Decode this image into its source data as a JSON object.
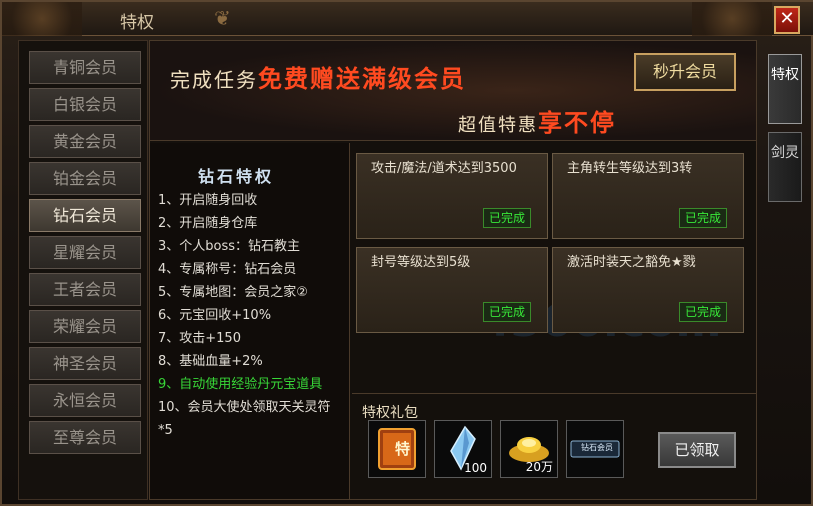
{
  "window": {
    "title": "特权",
    "close_label": "✕"
  },
  "sidebar": {
    "items": [
      {
        "label": "青铜会员"
      },
      {
        "label": "白银会员"
      },
      {
        "label": "黄金会员"
      },
      {
        "label": "铂金会员"
      },
      {
        "label": "钻石会员",
        "active": true
      },
      {
        "label": "星耀会员"
      },
      {
        "label": "王者会员"
      },
      {
        "label": "荣耀会员"
      },
      {
        "label": "神圣会员"
      },
      {
        "label": "永恒会员"
      },
      {
        "label": "至尊会员"
      }
    ]
  },
  "banner": {
    "line1_prefix": "完成任务",
    "line1_highlight": "免费赠送满级会员",
    "line2_prefix": "超值特惠",
    "line2_highlight": "享不停",
    "upgrade_button": "秒升会员"
  },
  "privileges": {
    "title": "钻石特权",
    "items": [
      {
        "text": "1、开启随身回收"
      },
      {
        "text": "2、开启随身仓库"
      },
      {
        "text": "3、个人boss：钻石教主"
      },
      {
        "text": "4、专属称号：钻石会员"
      },
      {
        "text": "5、专属地图：会员之家②"
      },
      {
        "text": "6、元宝回收+10%"
      },
      {
        "text": "7、攻击+150"
      },
      {
        "text": "8、基础血量+2%"
      },
      {
        "text": "9、自动使用经验丹元宝道具",
        "highlight": true
      },
      {
        "text": "10、会员大使处领取天关灵符*5"
      }
    ]
  },
  "tasks": [
    {
      "text": "攻击/魔法/道术达到3500",
      "status": "已完成"
    },
    {
      "text": "主角转生等级达到3转",
      "status": "已完成"
    },
    {
      "text": "封号等级达到5级",
      "status": "已完成"
    },
    {
      "text": "激活时装天之豁免★戮",
      "status": "已完成"
    }
  ],
  "gift": {
    "title": "特权礼包",
    "items": [
      {
        "icon": "vip-card-icon",
        "count": "",
        "badge": "特"
      },
      {
        "icon": "crystal-icon",
        "count": "100"
      },
      {
        "icon": "gold-ingot-icon",
        "count": "20万"
      },
      {
        "icon": "diamond-badge-icon",
        "count": "",
        "badge": "钻石会员"
      }
    ],
    "claim_button": "已领取"
  },
  "right_tabs": [
    {
      "label": "特权",
      "active": true
    },
    {
      "label": "剑灵"
    }
  ],
  "watermark": "4366.com",
  "colors": {
    "accent_red": "#ff4a20",
    "done_green": "#38e838",
    "active_item_text": "#f0e8d8",
    "inactive_item_text": "#9a948c"
  }
}
